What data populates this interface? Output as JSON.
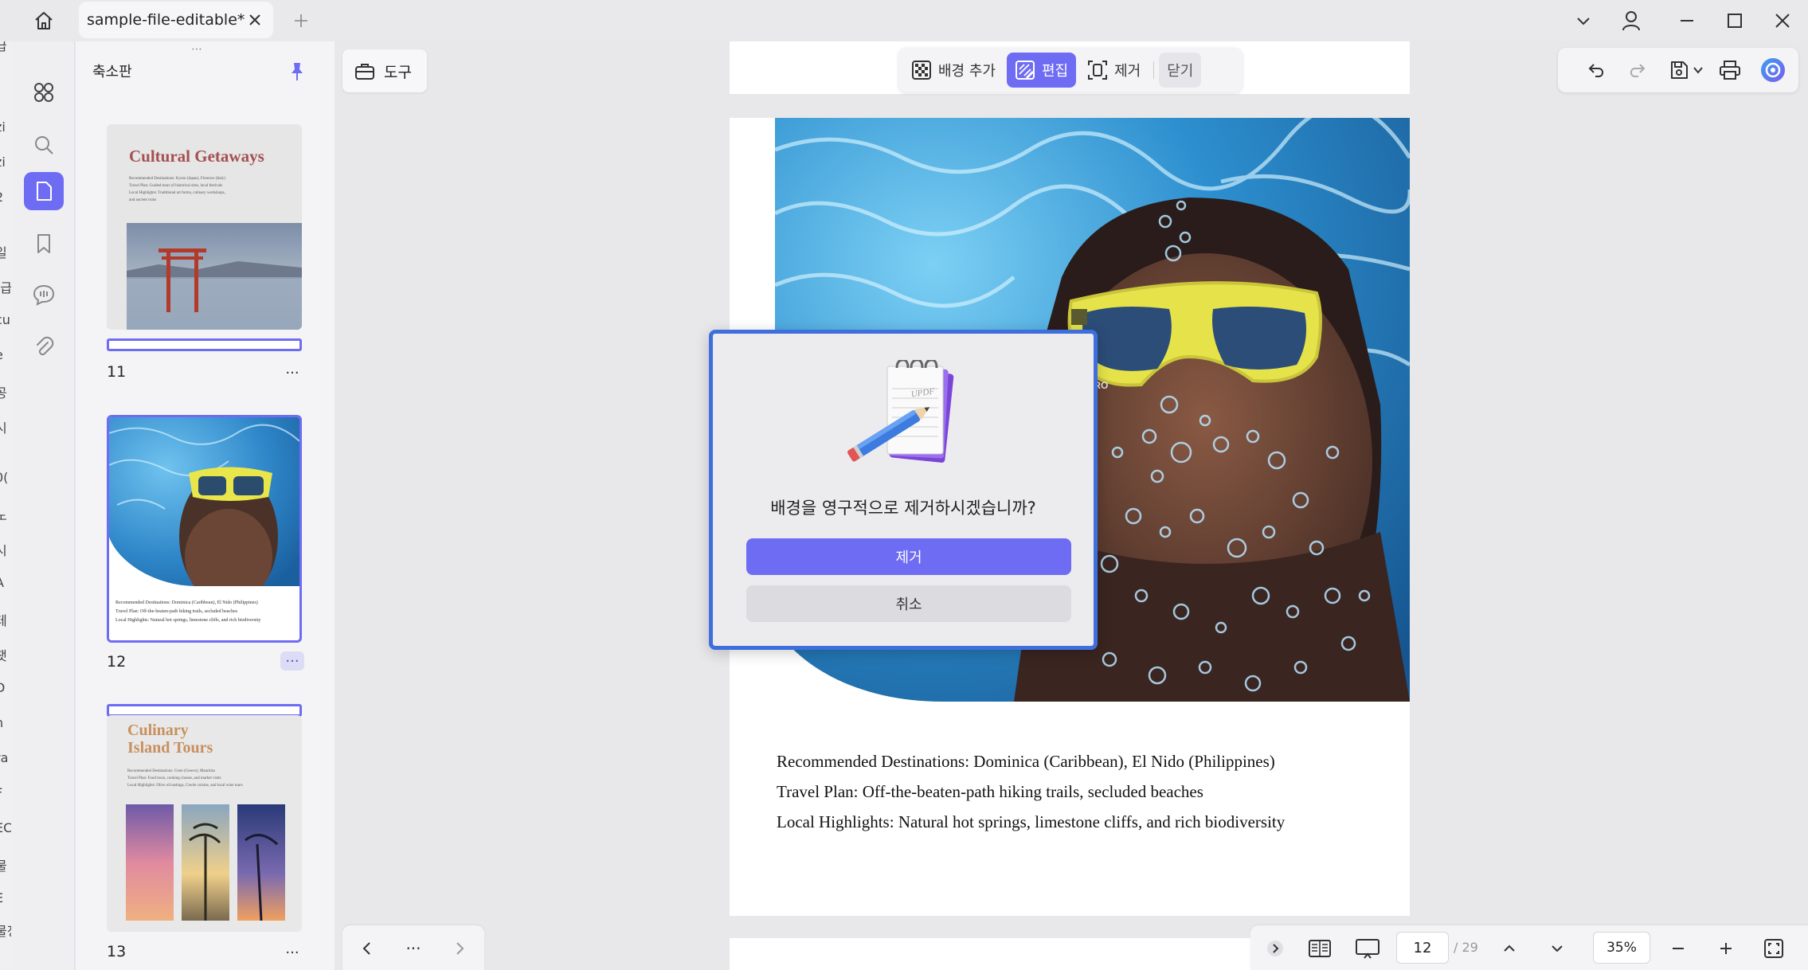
{
  "titlebar": {
    "tab_title": "sample-file-editable*"
  },
  "edge_strip": {
    "fragments": [
      "급",
      "zi",
      "zi",
      "2",
      "일",
      "[급",
      "cu",
      "e",
      "공",
      "시",
      "0(",
      "노",
      "시",
      "A",
      "테",
      "챗",
      "D",
      "n",
      "ra",
      "F",
      "EC",
      "물",
      "E",
      "물정"
    ]
  },
  "thumbnail_panel": {
    "title": "축소판",
    "pages": [
      {
        "number": "11",
        "heading": "Cultural Getaways",
        "lines": [
          "Recommended Destinations: Kyoto (Japan), Florence (Italy)",
          "Travel Plan: Guided tours of historical sites, local festivals",
          "Local Highlights: Traditional art forms, culinary workshops,",
          "and ancient ruins"
        ]
      },
      {
        "number": "12",
        "lines": [
          "Recommended Destinations: Dominica (Caribbean), El Nido (Philippines)",
          "Travel Plan: Off-the-beaten-path hiking trails, secluded beaches",
          "Local Highlights: Natural hot springs, limestone cliffs, and rich biodiversity"
        ]
      },
      {
        "number": "13",
        "heading_line1": "Culinary",
        "heading_line2": "Island Tours",
        "lines": [
          "Recommended Destinations: Crete (Greece), Mauritius",
          "Travel Plan: Food tours, cooking classes, and market visits",
          "Local Highlights: Olive oil tastings, Creole cuisine, and local wine tours"
        ]
      }
    ],
    "more_label": "···"
  },
  "toolbar": {
    "tools_label": "도구",
    "add_background": "배경 추가",
    "edit": "편집",
    "remove": "제거",
    "close": "닫기"
  },
  "document": {
    "lines": [
      "Recommended Destinations: Dominica (Caribbean), El Nido (Philippines)",
      "Travel Plan: Off-the-beaten-path hiking trails, secluded beaches",
      "Local Highlights: Natural hot springs, limestone cliffs, and rich biodiversity"
    ],
    "mask_brand": "BAPRO"
  },
  "dialog": {
    "notepad_text": "UPDF",
    "message": "배경을 영구적으로 제거하시겠습니까?",
    "confirm": "제거",
    "cancel": "취소"
  },
  "navbar": {
    "prev": "‹",
    "more": "···",
    "next": "›"
  },
  "statusbar": {
    "current_page": "12",
    "total_pages": "/ 29",
    "zoom": "35%"
  },
  "colors": {
    "accent": "#6f6cf4",
    "dialog_border": "#3f6fdd"
  }
}
